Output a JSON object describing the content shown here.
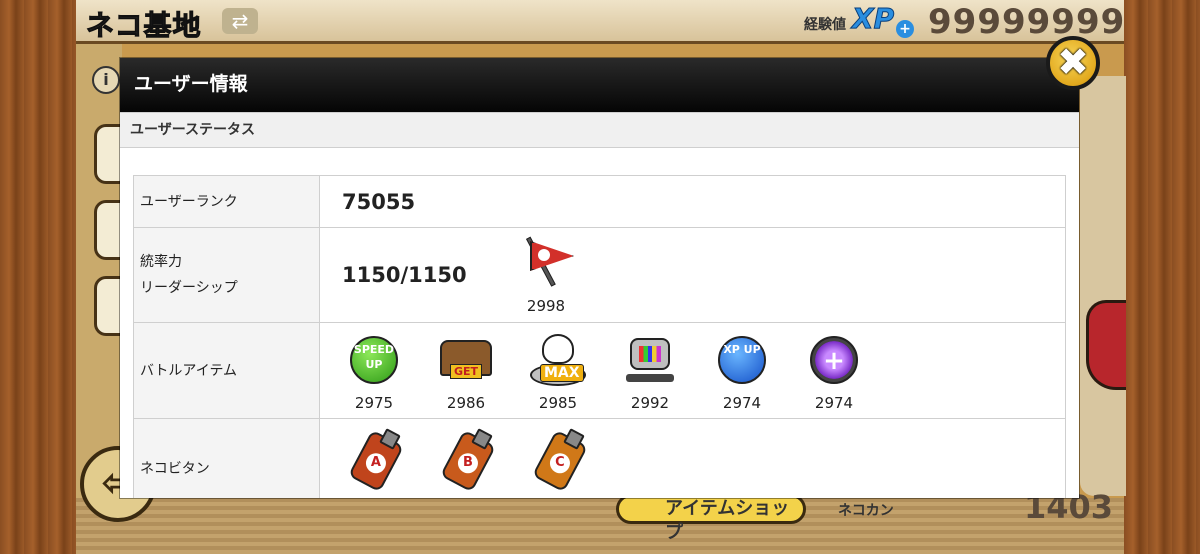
{
  "background": {
    "title": "ネコ基地",
    "xp_label": "経験値",
    "xp_badge": "XP",
    "xp_value": "99999999",
    "shop_label": "アイテムショップ",
    "catcan_label": "ネコカン",
    "catcan_value": "1403",
    "info_symbol": "i",
    "back_symbol": "⇦",
    "swap_symbol": "⇄"
  },
  "modal": {
    "title": "ユーザー情報",
    "section": "ユーザーステータス",
    "close_symbol": "✖",
    "rows": {
      "rank": {
        "label": "ユーザーランク",
        "value": "75055"
      },
      "leadership": {
        "label_line1": "統率力",
        "label_line2": "リーダーシップ",
        "value": "1150/1150",
        "flag_count": "2998"
      },
      "battle_items": {
        "label": "バトルアイテム",
        "items": [
          {
            "icon": "speed-up-icon",
            "text": "SPEED UP",
            "count": "2975"
          },
          {
            "icon": "treasure-radar-icon",
            "text": "GET",
            "count": "2986"
          },
          {
            "icon": "rich-cat-max-icon",
            "text": "MAX",
            "count": "2985"
          },
          {
            "icon": "cat-cpu-icon",
            "text": "",
            "count": "2992"
          },
          {
            "icon": "xp-up-icon",
            "text": "XP UP",
            "count": "2974"
          },
          {
            "icon": "sniper-cat-icon",
            "text": "",
            "count": "2974"
          }
        ]
      },
      "nekovitan": {
        "label": "ネコビタン",
        "items": [
          {
            "icon": "nekovitan-a-icon",
            "letter": "A"
          },
          {
            "icon": "nekovitan-b-icon",
            "letter": "B"
          },
          {
            "icon": "nekovitan-c-icon",
            "letter": "C"
          }
        ]
      }
    }
  }
}
